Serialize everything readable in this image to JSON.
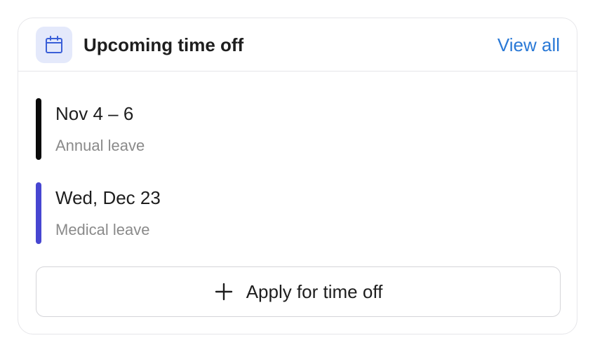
{
  "header": {
    "title": "Upcoming time off",
    "view_all_label": "View all",
    "icon": "calendar-icon"
  },
  "leaves": [
    {
      "date": "Nov 4 – 6",
      "type": "Annual leave",
      "color": "#0a0a0a"
    },
    {
      "date": "Wed, Dec 23",
      "type": "Medical leave",
      "color": "#4746d1"
    }
  ],
  "apply_button": {
    "label": "Apply for time off",
    "icon": "plus-icon"
  },
  "colors": {
    "accent": "#2a79d6",
    "icon_bg": "#e4e9fb",
    "icon_stroke": "#3a5fd8"
  }
}
